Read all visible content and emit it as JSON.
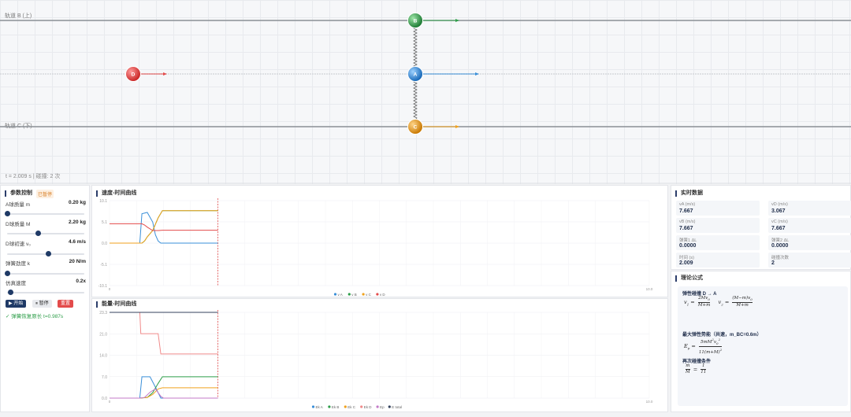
{
  "rails": {
    "b_label": "轨道 B (上)",
    "c_label": "轨道 C (下)"
  },
  "balls": {
    "a": "A",
    "b": "B",
    "c": "C",
    "d": "D"
  },
  "status": "t = 2.009 s | 碰撞: 2 次",
  "colors": {
    "a": "#3a8fd8",
    "b": "#2e9e4a",
    "c": "#f0a21e",
    "d": "#e34b4b",
    "accent": "#1f3a66"
  },
  "controls": {
    "title": "参数控制",
    "badge": "已暂停",
    "params": [
      {
        "label": "A球质量 m",
        "value": "0.20 kg",
        "frac": 0.02
      },
      {
        "label": "D球质量 M",
        "value": "2.20 kg",
        "frac": 0.4
      },
      {
        "label": "D球初速 v₀",
        "value": "4.6 m/s",
        "frac": 0.52
      },
      {
        "label": "弹簧劲度 k",
        "value": "20 N/m",
        "frac": 0.02
      },
      {
        "label": "仿真速度",
        "value": "0.2x",
        "frac": 0.05
      }
    ],
    "start": "▶ 开始",
    "pause": "⏸ 暂停",
    "reset": "重置",
    "note": "✓ 弹簧恢复原长 t=0.987s"
  },
  "chart_data": [
    {
      "type": "line",
      "title": "速度-时间曲线",
      "xlim": [
        0,
        10
      ],
      "ylim": [
        -10.1,
        10.1
      ],
      "yticks": [
        "10.1",
        "5.1",
        "0.0",
        "-5.1",
        "-10.1"
      ],
      "xticks": [
        "0",
        "10.0"
      ],
      "cursor_t": 2.009,
      "series": [
        {
          "name": "v A",
          "color": "#3a8fd8",
          "x": [
            0,
            0.56,
            0.6,
            0.7,
            0.8,
            0.85,
            0.9,
            0.95,
            2.009
          ],
          "y": [
            0,
            0,
            7.0,
            7.3,
            5,
            2,
            0.5,
            0,
            0
          ]
        },
        {
          "name": "v B",
          "color": "#2e9e4a",
          "x": [
            0,
            0.56,
            0.6,
            0.65,
            0.7,
            0.8,
            0.9,
            0.98,
            2.009
          ],
          "y": [
            0,
            0,
            0,
            0.5,
            1.5,
            3,
            6,
            7.7,
            7.7
          ]
        },
        {
          "name": "v C",
          "color": "#f0a21e",
          "x": [
            0,
            0.56,
            0.6,
            0.65,
            0.7,
            0.8,
            0.9,
            0.98,
            2.009
          ],
          "y": [
            0,
            0,
            0,
            0.5,
            1.5,
            3,
            6,
            7.7,
            7.7
          ]
        },
        {
          "name": "v D",
          "color": "#e34b4b",
          "x": [
            0,
            0.56,
            0.6,
            0.65,
            0.7,
            0.8,
            0.9,
            0.98,
            2.009
          ],
          "y": [
            4.6,
            4.6,
            4.6,
            4.3,
            3.8,
            3.0,
            3.0,
            3.07,
            3.07
          ]
        }
      ]
    },
    {
      "type": "line",
      "title": "能量-时间曲线",
      "xlim": [
        0,
        10
      ],
      "ylim": [
        0,
        23.3
      ],
      "yticks": [
        "23.3",
        "21.0",
        "14.0",
        "7.0",
        "0.0"
      ],
      "xticks": [
        "0",
        "10.0"
      ],
      "cursor_t": 2.009,
      "series": [
        {
          "name": "Ek A",
          "color": "#3a8fd8",
          "x": [
            0,
            0.56,
            0.6,
            0.75,
            0.85,
            0.95,
            2.009
          ],
          "y": [
            0,
            0,
            5.8,
            5.8,
            3,
            0,
            0
          ]
        },
        {
          "name": "Ek B",
          "color": "#2e9e4a",
          "x": [
            0,
            0.56,
            0.7,
            0.8,
            0.9,
            0.98,
            2.009
          ],
          "y": [
            0,
            0,
            0.2,
            1.5,
            4,
            5.8,
            5.8
          ]
        },
        {
          "name": "Ek C",
          "color": "#f0a21e",
          "x": [
            0,
            0.56,
            0.7,
            0.8,
            0.9,
            0.98,
            2.009
          ],
          "y": [
            0,
            0,
            0.2,
            1,
            2.5,
            2.8,
            2.8
          ]
        },
        {
          "name": "Ek D",
          "color": "#f08a8a",
          "x": [
            0,
            0.56,
            0.58,
            0.9,
            0.95,
            2.009
          ],
          "y": [
            23.3,
            23.3,
            17.5,
            17.5,
            12,
            12
          ]
        },
        {
          "name": "Ep",
          "color": "#c37ac8",
          "x": [
            0,
            0.56,
            0.65,
            0.75,
            0.85,
            0.95,
            1.0,
            2.009
          ],
          "y": [
            0,
            0,
            0.2,
            1.6,
            2.5,
            0.5,
            0,
            0
          ]
        },
        {
          "name": "E total",
          "color": "#33415e",
          "x": [
            0,
            2.009
          ],
          "y": [
            23.3,
            23.3
          ]
        }
      ]
    }
  ],
  "live": {
    "title": "实时数据",
    "cells": [
      {
        "k": "vA (m/s)",
        "v": "7.667"
      },
      {
        "k": "vD (m/s)",
        "v": "3.067"
      },
      {
        "k": "vB (m/s)",
        "v": "7.667"
      },
      {
        "k": "vC (m/s)",
        "v": "7.667"
      },
      {
        "k": "弹簧1 ΔL",
        "v": "0.0000"
      },
      {
        "k": "弹簧2 ΔL",
        "v": "0.0000"
      },
      {
        "k": "时间 (s)",
        "v": "2.009"
      },
      {
        "k": "碰撞次数",
        "v": "2"
      }
    ]
  },
  "theory": {
    "title": "理论公式",
    "h1": "弹性碰撞 D → A",
    "h2": "最大弹性势能（共速，m_BC=0.6m）",
    "h3": "再次碰撞条件"
  }
}
